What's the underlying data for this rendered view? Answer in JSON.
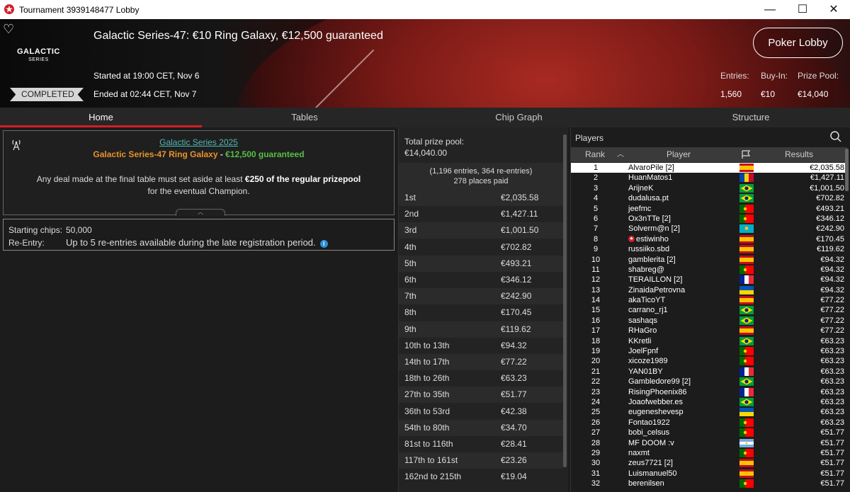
{
  "window": {
    "title": "Tournament 3939148477 Lobby",
    "minimize": "—",
    "maximize": "☐",
    "close": "✕"
  },
  "banner": {
    "title": "Galactic Series-47: €10 Ring Galaxy, €12,500 guaranteed",
    "logo_main": "GALACTIC",
    "logo_sub": "SERIES",
    "started": "Started at 19:00 CET, Nov 6",
    "ended": "Ended at 02:44 CET, Nov 7",
    "status": "COMPLETED",
    "lobby_button": "Poker Lobby",
    "entries_label": "Entries:",
    "entries_value": "1,560",
    "buyin_label": "Buy-In:",
    "buyin_value": "€10",
    "prizepool_label": "Prize Pool:",
    "prizepool_value": "€14,040"
  },
  "tabs": [
    {
      "label": "Home"
    },
    {
      "label": "Tables"
    },
    {
      "label": "Chip Graph"
    },
    {
      "label": "Structure"
    }
  ],
  "info": {
    "series_link": "Galactic Series 2025",
    "ring_name": "Galactic Series-47 Ring Galaxy",
    "ring_sep": " - ",
    "ring_guarantee": "€12,500 guaranteed",
    "deal_pre": "Any deal made at the final table must set aside at least ",
    "deal_bold": "€250 of the regular prizepool",
    "deal_post": "for the eventual Champion."
  },
  "chips": {
    "start_label": "Starting chips:",
    "start_value": "50,000",
    "reentry_label": "Re-Entry:",
    "reentry_value": "Up to 5 re-entries available during the late registration period."
  },
  "prize": {
    "total_label": "Total prize pool:",
    "total_value": "€14,040.00",
    "entries_line": "(1,196 entries, 364 re-entries)",
    "places_line": "278 places paid",
    "rows": [
      {
        "place": "1st",
        "amount": "€2,035.58"
      },
      {
        "place": "2nd",
        "amount": "€1,427.11"
      },
      {
        "place": "3rd",
        "amount": "€1,001.50"
      },
      {
        "place": "4th",
        "amount": "€702.82"
      },
      {
        "place": "5th",
        "amount": "€493.21"
      },
      {
        "place": "6th",
        "amount": "€346.12"
      },
      {
        "place": "7th",
        "amount": "€242.90"
      },
      {
        "place": "8th",
        "amount": "€170.45"
      },
      {
        "place": "9th",
        "amount": "€119.62"
      },
      {
        "place": "10th to 13th",
        "amount": "€94.32"
      },
      {
        "place": "14th to 17th",
        "amount": "€77.22"
      },
      {
        "place": "18th to 26th",
        "amount": "€63.23"
      },
      {
        "place": "27th to 35th",
        "amount": "€51.77"
      },
      {
        "place": "36th to 53rd",
        "amount": "€42.38"
      },
      {
        "place": "54th to 80th",
        "amount": "€34.70"
      },
      {
        "place": "81st to 116th",
        "amount": "€28.41"
      },
      {
        "place": "117th to 161st",
        "amount": "€23.26"
      },
      {
        "place": "162nd to 215th",
        "amount": "€19.04"
      }
    ]
  },
  "players": {
    "title": "Players",
    "col_rank": "Rank",
    "col_player": "Player",
    "col_results": "Results",
    "rows": [
      {
        "rank": "1",
        "name": "AlvaroPile [2]",
        "flag": "es",
        "result": "€2,035.58"
      },
      {
        "rank": "2",
        "name": "HuanMatos1",
        "flag": "md",
        "result": "€1,427.11"
      },
      {
        "rank": "3",
        "name": "ArijneK",
        "flag": "br",
        "result": "€1,001.50"
      },
      {
        "rank": "4",
        "name": "dudalusa.pt",
        "flag": "br",
        "result": "€702.82"
      },
      {
        "rank": "5",
        "name": "jeefmc",
        "flag": "pt",
        "result": "€493.21"
      },
      {
        "rank": "6",
        "name": "Ox3nTTe [2]",
        "flag": "pt",
        "result": "€346.12"
      },
      {
        "rank": "7",
        "name": "Solverm@n [2]",
        "flag": "kz",
        "result": "€242.90"
      },
      {
        "rank": "8",
        "name": "estiwinho",
        "flag": "es",
        "result": "€170.45",
        "star": "★"
      },
      {
        "rank": "9",
        "name": "russiiko.sbd",
        "flag": "es",
        "result": "€119.62"
      },
      {
        "rank": "10",
        "name": "gamblerita [2]",
        "flag": "es",
        "result": "€94.32"
      },
      {
        "rank": "11",
        "name": "shabreg@",
        "flag": "pt",
        "result": "€94.32"
      },
      {
        "rank": "12",
        "name": "TERAILLON [2]",
        "flag": "fr",
        "result": "€94.32"
      },
      {
        "rank": "13",
        "name": "ZinaidaPetrovna",
        "flag": "ua",
        "result": "€94.32"
      },
      {
        "rank": "14",
        "name": "akaTicoYT",
        "flag": "es",
        "result": "€77.22"
      },
      {
        "rank": "15",
        "name": "carrano_rj1",
        "flag": "br",
        "result": "€77.22"
      },
      {
        "rank": "16",
        "name": "sashaqs",
        "flag": "br",
        "result": "€77.22"
      },
      {
        "rank": "17",
        "name": "RHaGro",
        "flag": "es",
        "result": "€77.22"
      },
      {
        "rank": "18",
        "name": "KKretli",
        "flag": "br",
        "result": "€63.23"
      },
      {
        "rank": "19",
        "name": "JoelFpnf",
        "flag": "pt",
        "result": "€63.23"
      },
      {
        "rank": "20",
        "name": "xicoze1989",
        "flag": "pt",
        "result": "€63.23"
      },
      {
        "rank": "21",
        "name": "YAN01BY",
        "flag": "fr",
        "result": "€63.23"
      },
      {
        "rank": "22",
        "name": "Gambledore99 [2]",
        "flag": "br",
        "result": "€63.23"
      },
      {
        "rank": "23",
        "name": "RisingPhoenix86",
        "flag": "fr",
        "result": "€63.23"
      },
      {
        "rank": "24",
        "name": "Joaofwebber.es",
        "flag": "br",
        "result": "€63.23"
      },
      {
        "rank": "25",
        "name": "eugeneshevesp",
        "flag": "ua",
        "result": "€63.23"
      },
      {
        "rank": "26",
        "name": "Fontao1922",
        "flag": "pt",
        "result": "€63.23"
      },
      {
        "rank": "27",
        "name": "bobi_celsus",
        "flag": "pt",
        "result": "€51.77"
      },
      {
        "rank": "28",
        "name": "MF DOOM :v",
        "flag": "ar",
        "result": "€51.77"
      },
      {
        "rank": "29",
        "name": "naxmt",
        "flag": "pt",
        "result": "€51.77"
      },
      {
        "rank": "30",
        "name": "zeus7721 [2]",
        "flag": "es",
        "result": "€51.77"
      },
      {
        "rank": "31",
        "name": "Luismanuel50",
        "flag": "es",
        "result": "€51.77"
      },
      {
        "rank": "32",
        "name": "berenilsen",
        "flag": "pt",
        "result": "€51.77"
      }
    ]
  },
  "colors": {
    "accent": "#d21f26",
    "link": "#4fb8b4",
    "orange": "#e8922a",
    "green": "#56c042"
  }
}
